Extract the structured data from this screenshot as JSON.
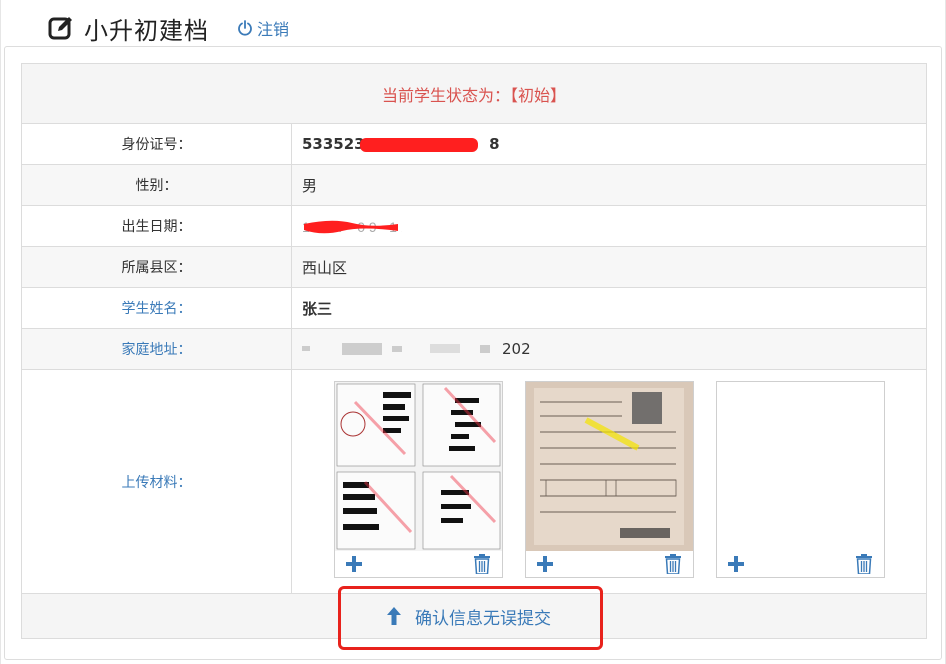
{
  "header": {
    "title": "小升初建档",
    "logout_label": "注销",
    "icons": {
      "title": "edit-square-icon",
      "logout": "power-icon"
    }
  },
  "status": {
    "text": "当前学生状态为：【初始】",
    "color": "#d9534f"
  },
  "fields": [
    {
      "label": "身份证号：",
      "value": "533523"
    },
    {
      "label": "性别：",
      "value": "男"
    },
    {
      "label": "出生日期：",
      "value": ""
    },
    {
      "label": "所属县区：",
      "value": "西山区"
    },
    {
      "label": "学生姓名：",
      "value": "张三"
    },
    {
      "label": "家庭地址：",
      "value": "202"
    }
  ],
  "id_tail": "8",
  "upload": {
    "label": "上传材料：",
    "cards": [
      {
        "name": "document-scan-1",
        "icons": [
          "plus-icon",
          "trash-icon"
        ]
      },
      {
        "name": "document-scan-2",
        "icons": [
          "plus-icon",
          "trash-icon"
        ]
      },
      {
        "name": "empty-slot",
        "icons": [
          "plus-icon",
          "trash-icon"
        ]
      }
    ]
  },
  "submit": {
    "label": "确认信息无误提交",
    "icon": "arrow-up-icon"
  },
  "colors": {
    "accent": "#3a7ab8",
    "status_red": "#d9534f",
    "highlight": "#e8221c"
  }
}
